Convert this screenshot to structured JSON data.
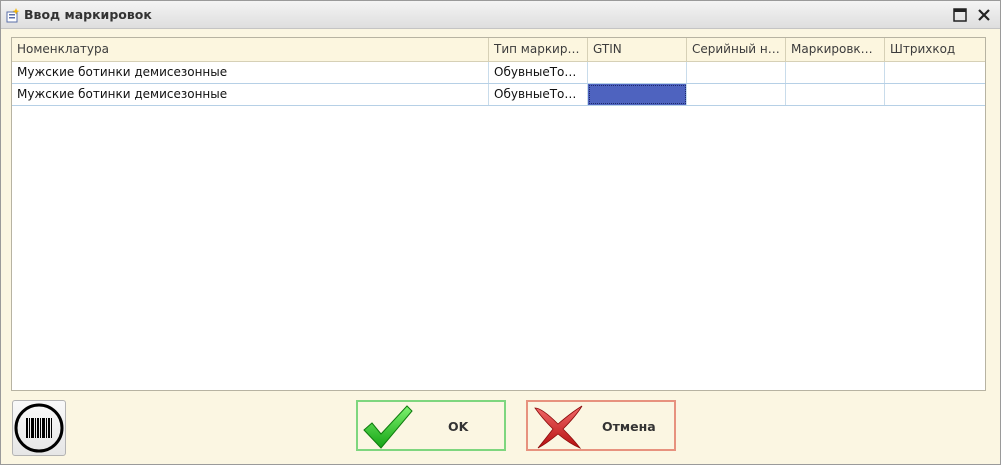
{
  "window": {
    "title": "Ввод маркировок",
    "icons": {
      "app": "app-form-icon",
      "maximize": "maximize-icon",
      "close": "close-icon"
    }
  },
  "table": {
    "columns": [
      "Номенклатура",
      "Тип маркир…",
      "GTIN",
      "Серийный н…",
      "Маркировк…",
      "Штрихкод"
    ],
    "rows": [
      [
        "Мужские ботинки демисезонные",
        "ОбувныеТо…",
        "",
        "",
        "",
        ""
      ],
      [
        "Мужские ботинки демисезонные",
        "ОбувныеТо…",
        "",
        "",
        "",
        ""
      ]
    ],
    "selected_cell": {
      "row": 2,
      "column": "GTIN"
    },
    "colors": {
      "header_bg": "#fcf6df",
      "selection": "#4e63bf",
      "row_line": "#b6d0e6"
    }
  },
  "buttons": {
    "barcode": {
      "icon": "barcode-scan-icon"
    },
    "ok": {
      "label": "OK",
      "icon": "checkmark-icon",
      "border": "#7ed67e"
    },
    "cancel": {
      "label": "Отмена",
      "icon": "red-x-icon",
      "border": "#e7927e"
    }
  }
}
